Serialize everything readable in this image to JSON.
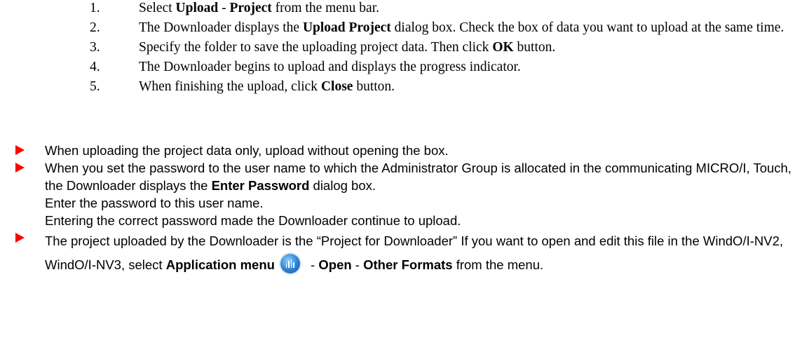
{
  "steps": [
    {
      "num": "1.",
      "t1": "Select ",
      "b1": "Upload",
      "t2": " - ",
      "b2": "Project",
      "t3": " from the menu bar."
    },
    {
      "num": "2.",
      "t1": "The Downloader displays the ",
      "b1": "Upload Project",
      "t2": " dialog box. Check the box of data you want to upload at the same time."
    },
    {
      "num": "3.",
      "t1": "Specify the folder to save the uploading project data. Then click ",
      "b1": "OK",
      "t2": " button."
    },
    {
      "num": "4.",
      "t1": "The Downloader begins to upload and displays the progress indicator."
    },
    {
      "num": "5.",
      "t1": "When finishing the upload, click ",
      "b1": "Close",
      "t2": " button."
    }
  ],
  "notes": {
    "n1": {
      "text": "When uploading the project data only, upload without opening the box."
    },
    "n2": {
      "t1": "When you set the password to the user name to which the Administrator Group is allocated in the communicating MICRO/I, Touch, the Downloader displays the ",
      "b1": "Enter Password",
      "t2": " dialog box.",
      "p2": "Enter the password to this user name.",
      "p3": "Entering the correct password made the Downloader continue to upload."
    },
    "n3": {
      "t1": "The project uploaded by the Downloader is the “Project for Downloader” If you want to open and edit this file in the WindO/I-NV2, WindO/I-NV3, select ",
      "b1": "Application menu",
      "icon": "application-menu-icon",
      "t2": " - ",
      "b2": "Open",
      "t3": " - ",
      "b3": "Other Formats",
      "t4": " from the menu."
    }
  },
  "colors": {
    "marker": "#ff0000",
    "icon": "#2d7fd0"
  }
}
